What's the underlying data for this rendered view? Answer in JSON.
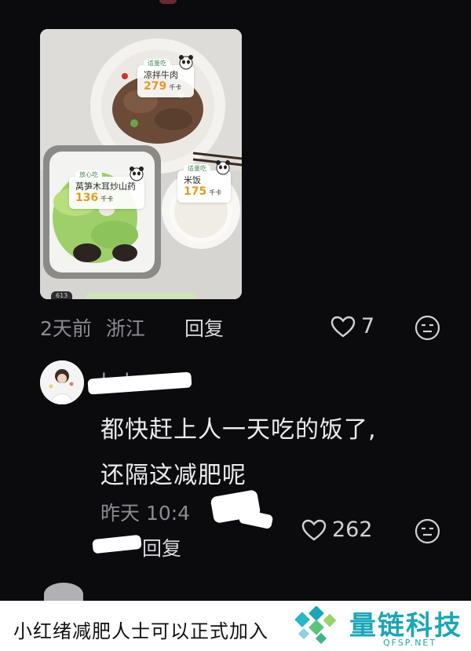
{
  "post": {
    "meta_time": "2天前",
    "meta_location": "浙江",
    "reply_label": "回复",
    "like_count": "7",
    "photo": {
      "labels": [
        {
          "tag": "适量吃",
          "name": "凉拌牛肉",
          "calories": "279",
          "unit": "千卡"
        },
        {
          "tag": "放心吃",
          "name": "莴笋木耳炒山药",
          "calories": "136",
          "unit": "千卡"
        },
        {
          "tag": "适量吃",
          "name": "米饭",
          "calories": "175",
          "unit": "千卡"
        }
      ],
      "footer_badge": "613"
    }
  },
  "comment": {
    "username_partial": "l...ka",
    "line1": "都快赶上人一天吃的饭了,",
    "line2": "还隔这减肥呢",
    "meta_time": "昨天 10:4",
    "reply_label": "回复",
    "like_count": "262"
  },
  "caption": {
    "text": "小红绪减肥人士可以正式加入",
    "brand_name": "量链科技",
    "brand_url": "QFSP.NET"
  },
  "colors": {
    "background": "#0b0b0d",
    "meta_text": "#8b8b93",
    "calorie": "#e29a28",
    "brand": "#1aa6b7"
  }
}
